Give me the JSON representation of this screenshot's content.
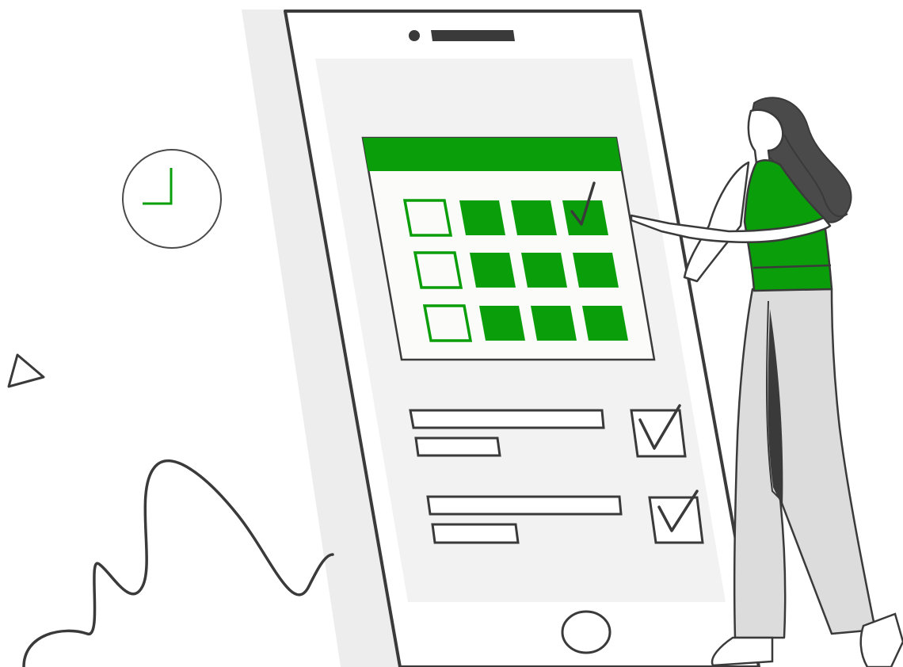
{
  "colors": {
    "accent_green": "#0a9e0a",
    "outline": "#3a3a3a",
    "screen_bg": "#f2f2f2",
    "phone_shadow": "#ededed",
    "pants": "#dcdcdc",
    "hair": "#4a4a4a",
    "background": "#ffffff"
  },
  "calendar": {
    "rows": 3,
    "cols": 4,
    "cells": [
      [
        "outline",
        "filled",
        "filled",
        "checked"
      ],
      [
        "outline",
        "filled",
        "filled",
        "filled"
      ],
      [
        "outline",
        "filled",
        "filled",
        "filled"
      ]
    ]
  },
  "checklist": {
    "items": [
      {
        "checked": true
      },
      {
        "checked": true
      }
    ]
  },
  "icons": [
    "clock-icon",
    "triangle-icon",
    "checkmark-icon",
    "home-button-icon"
  ]
}
